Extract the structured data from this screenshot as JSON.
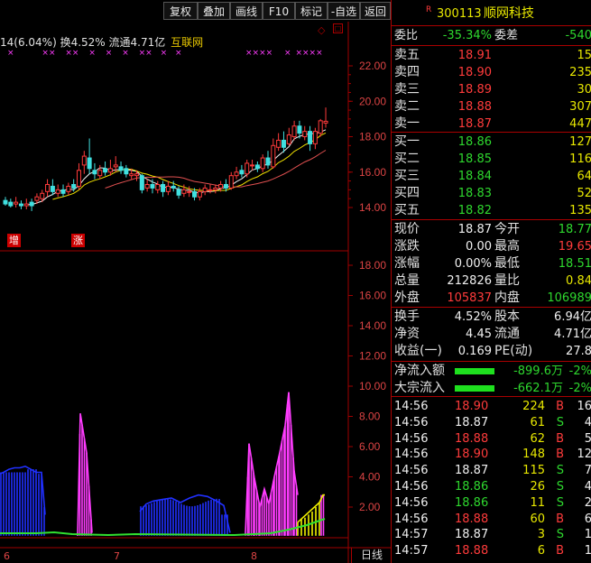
{
  "toolbar": {
    "buttons": [
      "复权",
      "叠加",
      "画线",
      "F10",
      "标记",
      "-自选",
      "返回"
    ]
  },
  "header": {
    "r_mark": "R",
    "code": "300113",
    "name": "顺网科技"
  },
  "chart_header": {
    "info_text": "14(6.04%) 换4.52% 流通4.71亿",
    "sector": "互联网",
    "markers_left": [
      "×",
      "××",
      "××",
      "×",
      "×",
      "×",
      "××",
      "×",
      "×"
    ],
    "markers_right": [
      "××××",
      "×",
      "××××"
    ]
  },
  "price_axis": {
    "ticks": [
      "22.00",
      "20.00",
      "18.00",
      "16.00",
      "14.00"
    ]
  },
  "badges": {
    "zeng": "增",
    "zhang": "涨"
  },
  "indicator_axis": {
    "ticks": [
      "18.00",
      "16.00",
      "14.00",
      "12.00",
      "10.00",
      "8.00",
      "6.00",
      "4.00",
      "2.00"
    ]
  },
  "x_axis": {
    "labels": [
      "6",
      "7",
      "8"
    ],
    "period": "日线"
  },
  "quote": {
    "weibi_label": "委比",
    "weibi": "-35.34%",
    "weicha_label": "委差",
    "weicha": "-540",
    "asks": [
      {
        "label": "卖五",
        "price": "18.91",
        "vol": "15"
      },
      {
        "label": "卖四",
        "price": "18.90",
        "vol": "235"
      },
      {
        "label": "卖三",
        "price": "18.89",
        "vol": "30"
      },
      {
        "label": "卖二",
        "price": "18.88",
        "vol": "307"
      },
      {
        "label": "卖一",
        "price": "18.87",
        "vol": "447"
      }
    ],
    "bids": [
      {
        "label": "买一",
        "price": "18.86",
        "vol": "127"
      },
      {
        "label": "买二",
        "price": "18.85",
        "vol": "116"
      },
      {
        "label": "买三",
        "price": "18.84",
        "vol": "64"
      },
      {
        "label": "买四",
        "price": "18.83",
        "vol": "52"
      },
      {
        "label": "买五",
        "price": "18.82",
        "vol": "135"
      }
    ],
    "stats": [
      {
        "l1": "现价",
        "v1": "18.87",
        "l2": "今开",
        "v2": "18.77"
      },
      {
        "l1": "涨跌",
        "v1": "0.00",
        "l2": "最高",
        "v2": "19.65"
      },
      {
        "l1": "涨幅",
        "v1": "0.00%",
        "l2": "最低",
        "v2": "18.51"
      },
      {
        "l1": "总量",
        "v1": "212826",
        "l2": "量比",
        "v2": "0.84"
      },
      {
        "l1": "外盘",
        "v1": "105837",
        "l2": "内盘",
        "v2": "106989"
      }
    ],
    "fund": [
      {
        "l1": "换手",
        "v1": "4.52%",
        "l2": "股本",
        "v2": "6.94亿"
      },
      {
        "l1": "净资",
        "v1": "4.45",
        "l2": "流通",
        "v2": "4.71亿"
      },
      {
        "l1": "收益(一)",
        "v1": "0.169",
        "l2": "PE(动)",
        "v2": "27.8"
      }
    ],
    "flow": [
      {
        "label": "净流入额",
        "value": "-899.6万",
        "pct": "-2%"
      },
      {
        "label": "大宗流入",
        "value": "-662.1万",
        "pct": "-2%"
      }
    ],
    "ticks": [
      {
        "time": "14:56",
        "price": "18.90",
        "vol": "224",
        "side": "B",
        "n": "16"
      },
      {
        "time": "14:56",
        "price": "18.87",
        "vol": "61",
        "side": "S",
        "n": "4"
      },
      {
        "time": "14:56",
        "price": "18.88",
        "vol": "62",
        "side": "B",
        "n": "5"
      },
      {
        "time": "14:56",
        "price": "18.90",
        "vol": "148",
        "side": "B",
        "n": "12"
      },
      {
        "time": "14:56",
        "price": "18.87",
        "vol": "115",
        "side": "S",
        "n": "7"
      },
      {
        "time": "14:56",
        "price": "18.86",
        "vol": "26",
        "side": "S",
        "n": "4"
      },
      {
        "time": "14:56",
        "price": "18.86",
        "vol": "11",
        "side": "S",
        "n": "2"
      },
      {
        "time": "14:56",
        "price": "18.88",
        "vol": "60",
        "side": "B",
        "n": "6"
      },
      {
        "time": "14:57",
        "price": "18.87",
        "vol": "3",
        "side": "S",
        "n": "1"
      },
      {
        "time": "14:57",
        "price": "18.88",
        "vol": "6",
        "side": "B",
        "n": "1"
      }
    ]
  },
  "colors": {
    "up": "#ff3b3b",
    "down": "#2ed82e",
    "cyan": "#40e0e0",
    "magenta": "#ff3cff",
    "blue": "#2030ff",
    "yellow": "#f0f000",
    "grid": "#a00000"
  }
}
